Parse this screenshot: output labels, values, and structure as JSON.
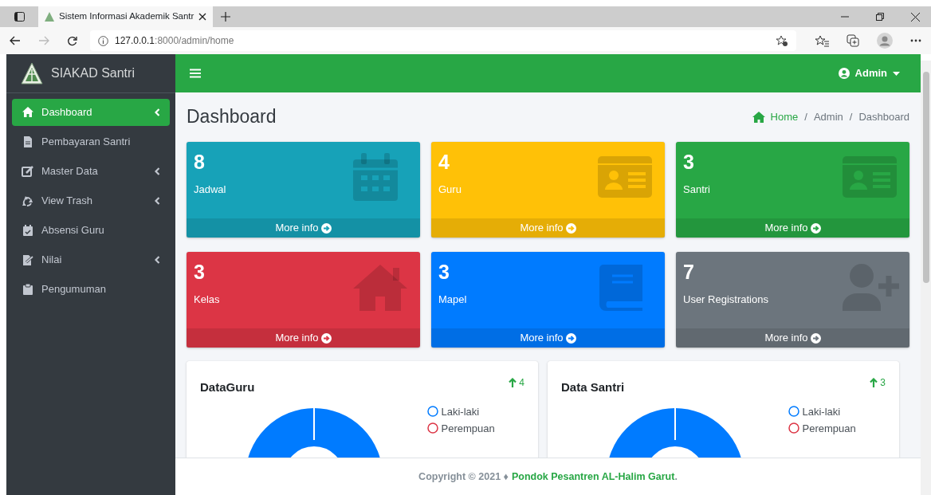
{
  "browser": {
    "tab_title": "Sistem Informasi Akademik Santr",
    "url_host": "127.0.0.1",
    "url_path": ":8000/admin/home"
  },
  "sidebar": {
    "brand": "SIAKAD Santri",
    "items": [
      {
        "label": "Dashboard",
        "selected": true,
        "expandable": true
      },
      {
        "label": "Pembayaran Santri",
        "selected": false,
        "expandable": false
      },
      {
        "label": "Master Data",
        "selected": false,
        "expandable": true
      },
      {
        "label": "View Trash",
        "selected": false,
        "expandable": true
      },
      {
        "label": "Absensi Guru",
        "selected": false,
        "expandable": false
      },
      {
        "label": "Nilai",
        "selected": false,
        "expandable": true
      },
      {
        "label": "Pengumuman",
        "selected": false,
        "expandable": false
      }
    ]
  },
  "navbar": {
    "user": "Admin"
  },
  "page_title": "Dashboard",
  "breadcrumb": [
    {
      "label": "Home",
      "link": true
    },
    {
      "label": "Admin",
      "link": false,
      "separator": "/"
    },
    {
      "label": "Dashboard",
      "link": false,
      "separator": "/"
    }
  ],
  "stat_boxes": [
    {
      "value": "8",
      "label": "Jadwal",
      "color": "#17a2b8",
      "link": "More info"
    },
    {
      "value": "4",
      "label": "Guru",
      "color": "#ffc107",
      "link": "More info"
    },
    {
      "value": "3",
      "label": "Santri",
      "color": "#28a745",
      "link": "More info"
    },
    {
      "value": "3",
      "label": "Kelas",
      "color": "#dc3545",
      "link": "More info"
    },
    {
      "value": "3",
      "label": "Mapel",
      "color": "#007bff",
      "link": "More info"
    },
    {
      "value": "7",
      "label": "User Registrations",
      "color": "#6c757d",
      "link": "More info"
    }
  ],
  "charts": [
    {
      "title": "DataGuru",
      "trend": "4",
      "legend": [
        {
          "label": "Laki-laki",
          "color": "#007bff"
        },
        {
          "label": "Perempuan",
          "color": "#dc3545"
        }
      ]
    },
    {
      "title": "Data Santri",
      "trend": "3",
      "legend": [
        {
          "label": "Laki-laki",
          "color": "#007bff"
        },
        {
          "label": "Perempuan",
          "color": "#dc3545"
        }
      ]
    }
  ],
  "footer": {
    "prefix": "Copyright © 2021 ♦",
    "link": "Pondok Pesantren AL-Halim Garut",
    "suffix": "."
  }
}
